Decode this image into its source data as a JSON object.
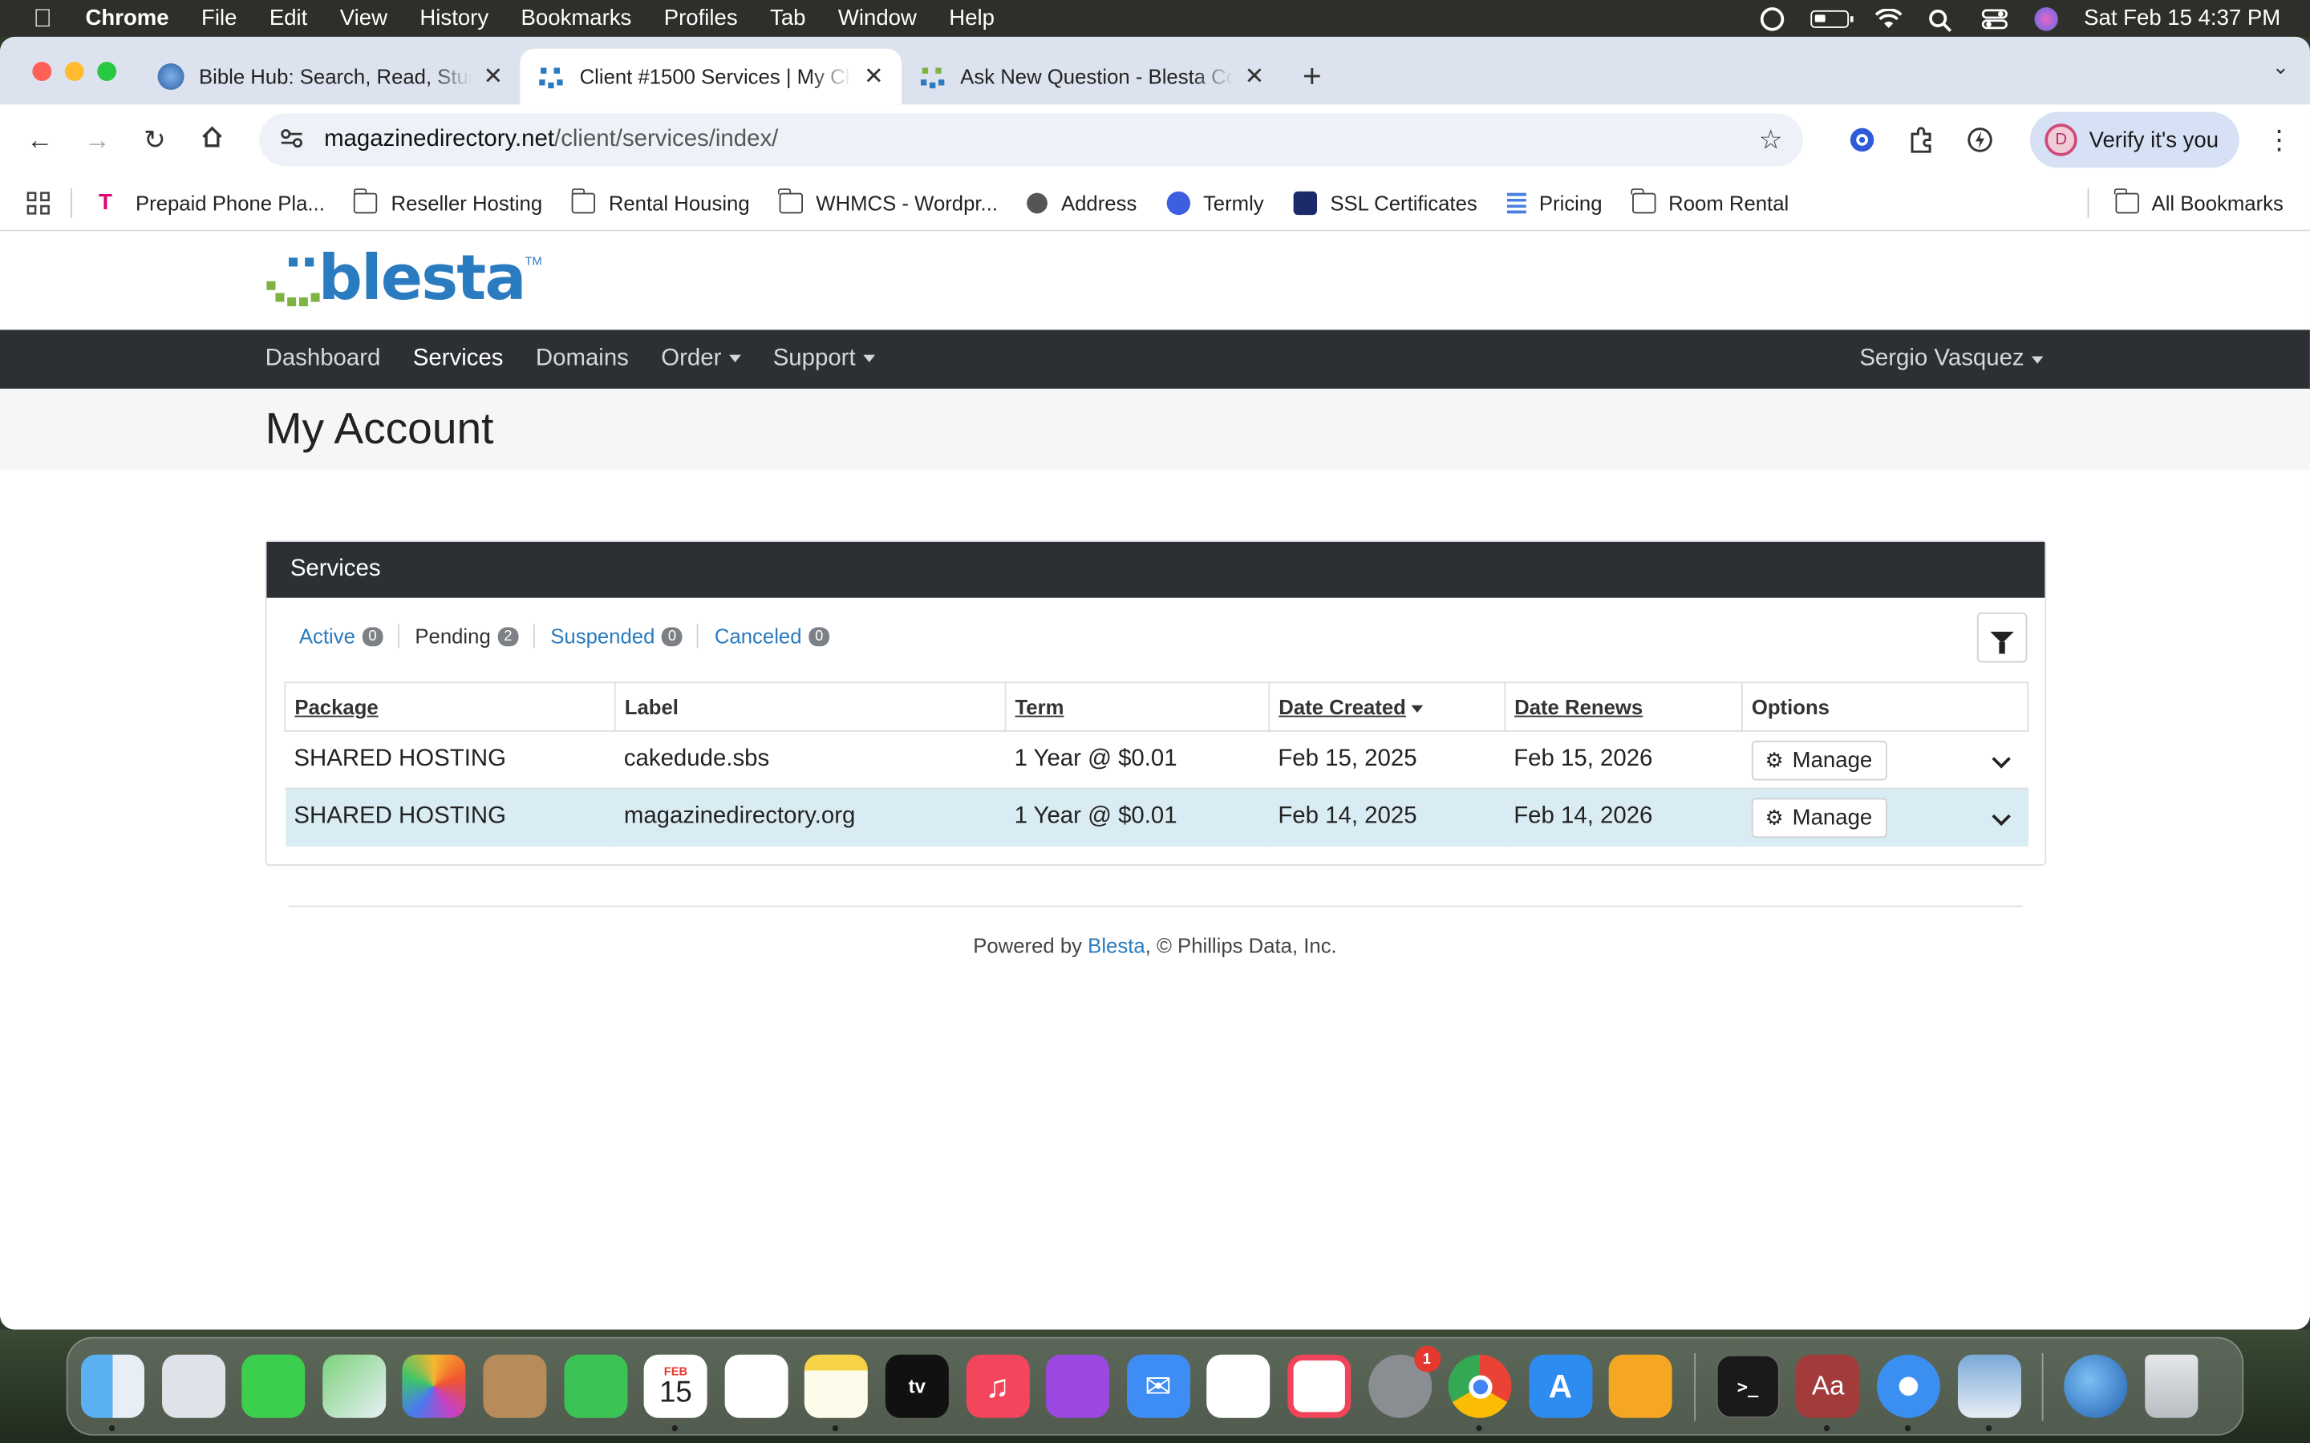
{
  "menubar": {
    "app": "Chrome",
    "menus": [
      "File",
      "Edit",
      "View",
      "History",
      "Bookmarks",
      "Profiles",
      "Tab",
      "Window",
      "Help"
    ],
    "clock": "Sat Feb 15  4:37 PM"
  },
  "tabs": [
    {
      "title": "Bible Hub: Search, Read, Stud"
    },
    {
      "title": "Client #1500 Services | My Cl"
    },
    {
      "title": "Ask New Question - Blesta Co"
    }
  ],
  "toolbar": {
    "url_host": "magazinedirectory.net",
    "url_path": "/client/services/index/",
    "verify_label": "Verify it's you",
    "avatar_letter": "D"
  },
  "bookmarks": [
    {
      "label": "Prepaid Phone Pla...",
      "icon": "t-mobile-icon"
    },
    {
      "label": "Reseller Hosting",
      "icon": "folder-icon"
    },
    {
      "label": "Rental Housing",
      "icon": "folder-icon"
    },
    {
      "label": "WHMCS - Wordpr...",
      "icon": "folder-icon"
    },
    {
      "label": "Address",
      "icon": "globe-icon"
    },
    {
      "label": "Termly",
      "icon": "termly-icon"
    },
    {
      "label": "SSL Certificates",
      "icon": "ssl-icon"
    },
    {
      "label": "Pricing",
      "icon": "doc-icon"
    },
    {
      "label": "Room Rental",
      "icon": "folder-icon"
    }
  ],
  "all_bookmarks_label": "All Bookmarks",
  "site": {
    "logo_text": "blesta",
    "logo_tm": "TM",
    "nav": [
      {
        "label": "Dashboard"
      },
      {
        "label": "Services"
      },
      {
        "label": "Domains"
      },
      {
        "label": "Order"
      },
      {
        "label": "Support"
      }
    ],
    "user": "Sergio Vasquez",
    "page_title": "My Account"
  },
  "services": {
    "heading": "Services",
    "filters": [
      {
        "label": "Active",
        "count": "0"
      },
      {
        "label": "Pending",
        "count": "2"
      },
      {
        "label": "Suspended",
        "count": "0"
      },
      {
        "label": "Canceled",
        "count": "0"
      }
    ],
    "columns": [
      "Package",
      "Label",
      "Term",
      "Date Created",
      "Date Renews",
      "Options"
    ],
    "rows": [
      {
        "package": "SHARED HOSTING",
        "label": "cakedude.sbs",
        "term": "1 Year @ $0.01",
        "created": "Feb 15, 2025",
        "renews": "Feb 15, 2026",
        "action": "Manage"
      },
      {
        "package": "SHARED HOSTING",
        "label": "magazinedirectory.org",
        "term": "1 Year @ $0.01",
        "created": "Feb 14, 2025",
        "renews": "Feb 14, 2026",
        "action": "Manage"
      }
    ]
  },
  "footer": {
    "prefix": "Powered by ",
    "link": "Blesta",
    "suffix": ", © Phillips Data, Inc."
  },
  "dock": {
    "calendar_month": "FEB",
    "calendar_day": "15",
    "settings_badge": "1",
    "tv_label": "tv",
    "dict_label": "Aa"
  }
}
